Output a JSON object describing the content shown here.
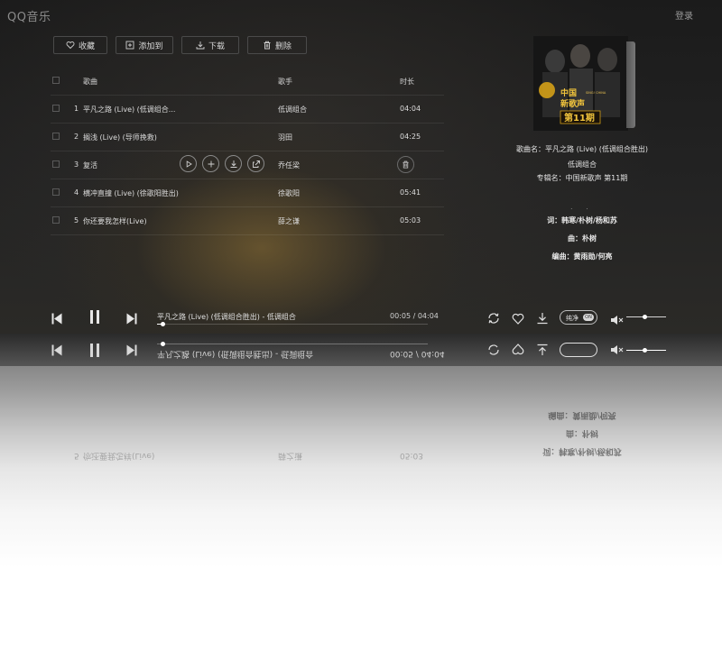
{
  "app": {
    "logo": "QQ音乐",
    "login_label": "登录"
  },
  "toolbar": {
    "buttons": [
      {
        "label": "收藏",
        "icon": "heart-icon"
      },
      {
        "label": "添加到",
        "icon": "add-box-icon"
      },
      {
        "label": "下载",
        "icon": "download-icon"
      },
      {
        "label": "删除",
        "icon": "trash-icon"
      }
    ]
  },
  "table": {
    "headers": {
      "song": "歌曲",
      "singer": "歌手",
      "duration": "时长"
    },
    "rows": [
      {
        "index": "1",
        "song": "平凡之路 (Live) (低调组合...",
        "singer": "低调组合",
        "duration": "04:04"
      },
      {
        "index": "2",
        "song": "搁浅 (Live) (导师挽救)",
        "singer": "羽田",
        "duration": "04:25"
      },
      {
        "index": "3",
        "song": "复活",
        "singer": "乔任梁",
        "duration": "",
        "hovered": true
      },
      {
        "index": "4",
        "song": "横冲直撞 (Live) (徐歌阳胜出)",
        "singer": "徐歌阳",
        "duration": "05:41"
      },
      {
        "index": "5",
        "song": "你还要我怎样(Live)",
        "singer": "薛之谦",
        "duration": "05:03"
      }
    ]
  },
  "album": {
    "cover_lines": [
      "中国",
      "新歌声",
      "第11期"
    ],
    "cover_small": "SING! CHINA",
    "song_name": "歌曲名：平凡之路 (Live) (低调组合胜出)",
    "artist": "低调组合",
    "album_name": "专辑名：中国新歌声 第11期"
  },
  "lyrics": {
    "dots": ". .",
    "lyricist": "词：韩寒/朴树/杨和苏",
    "composer": "曲：朴树",
    "arranger": "编曲：黄雨勋/何亮"
  },
  "player": {
    "now_playing": "平凡之路 (Live) (低调组合胜出) - 低调组合",
    "time": "00:05 / 04:04",
    "progress_fraction": 0.02,
    "pure_label": "纯净",
    "pure_switch": "ON",
    "volume_fraction": 0.45
  },
  "colors": {
    "background": "#1f1f1f",
    "accent": "#d4a017",
    "text": "#dcdcdc"
  }
}
